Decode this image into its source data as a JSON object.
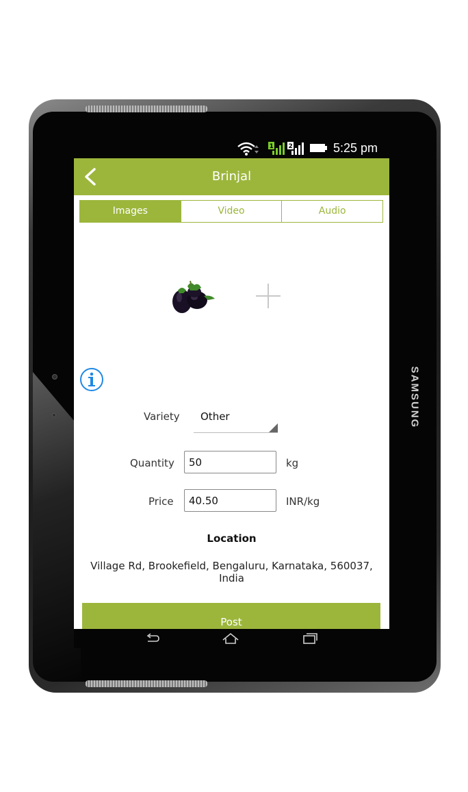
{
  "device": {
    "brand": "SAMSUNG"
  },
  "status_bar": {
    "time": "5:25 pm",
    "icons": [
      "wifi-icon",
      "sim1-signal-icon",
      "sim2-signal-icon",
      "battery-icon"
    ],
    "sim1_label": "1",
    "sim2_label": "2"
  },
  "app_bar": {
    "title": "Brinjal",
    "back_icon": "chevron-left-icon"
  },
  "tabs": [
    {
      "label": "Images",
      "active": true
    },
    {
      "label": "Video",
      "active": false
    },
    {
      "label": "Audio",
      "active": false
    }
  ],
  "media": {
    "image_name": "brinjal-photo",
    "add_icon": "plus-icon"
  },
  "info_icon": "info-icon",
  "form": {
    "variety_label": "Variety",
    "variety_value": "Other",
    "quantity_label": "Quantity",
    "quantity_value": "50",
    "quantity_unit": "kg",
    "price_label": "Price",
    "price_value": "40.50",
    "price_unit": "INR/kg"
  },
  "location": {
    "title": "Location",
    "address": "Village Rd, Brookefield, Bengaluru, Karnataka, 560037, India"
  },
  "post_button": {
    "label": "Post"
  },
  "colors": {
    "accent": "#9cb63c",
    "info": "#1e88e5",
    "signal_green": "#7ccc2b"
  },
  "nav_bar": {
    "icons": [
      "back-icon",
      "home-icon",
      "recents-icon"
    ]
  }
}
